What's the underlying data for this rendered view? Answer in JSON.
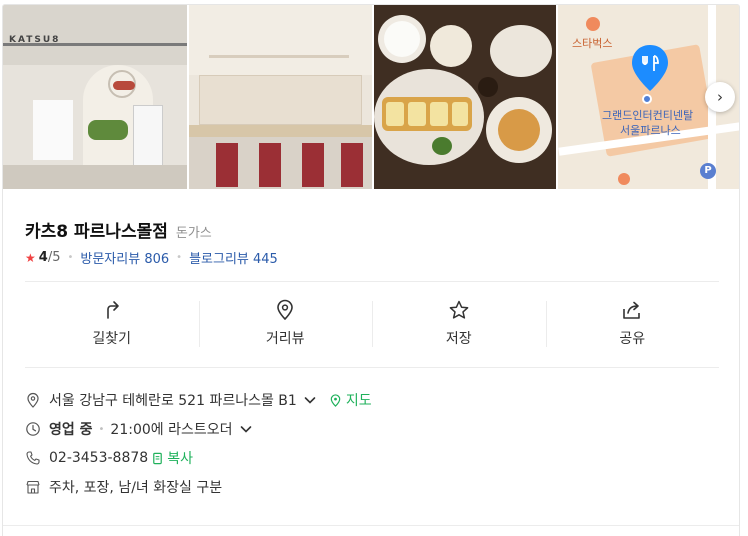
{
  "photos": {
    "photo1_sign": "KATSU8",
    "map_labels": {
      "starbucks": "스타벅스",
      "hotel_line1": "그랜드인터컨티넨탈",
      "hotel_line2": "서울파르나스"
    }
  },
  "place": {
    "name": "카츠8 파르나스몰점",
    "category": "돈가스",
    "rating": "4",
    "rating_max": "/5",
    "visitor_reviews_label": "방문자리뷰",
    "visitor_reviews_count": "806",
    "blog_reviews_label": "블로그리뷰",
    "blog_reviews_count": "445"
  },
  "actions": [
    {
      "label": "길찾기",
      "icon": "directions-icon"
    },
    {
      "label": "거리뷰",
      "icon": "street-view-icon"
    },
    {
      "label": "저장",
      "icon": "star-icon"
    },
    {
      "label": "공유",
      "icon": "share-icon"
    }
  ],
  "info": {
    "address": "서울 강남구 테헤란로 521 파르나스몰 B1",
    "map_link": "지도",
    "status": "영업 중",
    "last_order": "21:00에 라스트오더",
    "phone": "02-3453-8878",
    "copy_label": "복사",
    "amenities": "주차, 포장, 남/녀 화장실 구분"
  },
  "colors": {
    "accent_green": "#1fb15b",
    "link_blue": "#2b5baa",
    "star_red": "#f04242"
  }
}
